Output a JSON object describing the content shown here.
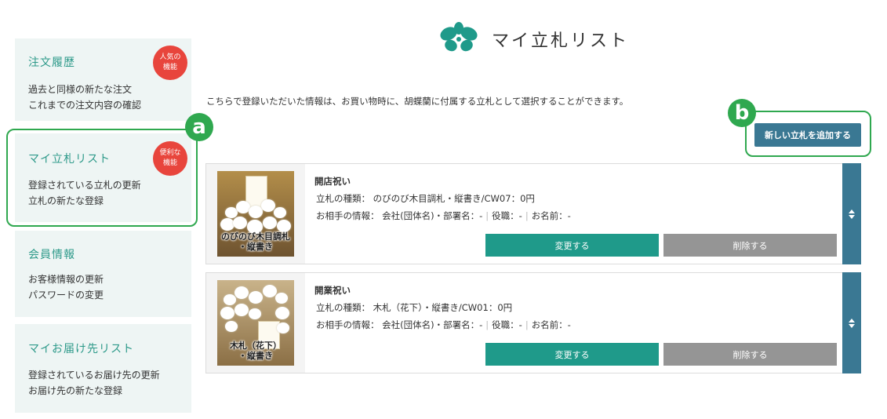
{
  "sidebar": {
    "cards": [
      {
        "title": "注文履歴",
        "badge": [
          "人気の",
          "機能"
        ],
        "lines": [
          "過去と同様の新たな注文",
          "これまでの注文内容の確認"
        ]
      },
      {
        "title": "マイ立札リスト",
        "badge": [
          "便利な",
          "機能"
        ],
        "lines": [
          "登録されている立札の更新",
          "立札の新たな登録"
        ]
      },
      {
        "title": "会員情報",
        "lines": [
          "お客様情報の更新",
          "パスワードの変更"
        ]
      },
      {
        "title": "マイお届け先リスト",
        "lines": [
          "登録されているお届け先の更新",
          "お届け先の新たな登録"
        ]
      }
    ]
  },
  "annotations": {
    "a": "a",
    "b": "b",
    "color": "#2fa84f"
  },
  "header": {
    "title": "マイ立札リスト",
    "logo_icon": "orchid-logo-icon",
    "logo_color": "#1f9a8a"
  },
  "intro": "こちらで登録いただいた情報は、お買い物時に、胡蝶蘭に付属する立札として選択することができます。",
  "add_button": "新しい立札を追加する",
  "items": [
    {
      "name": "開店祝い",
      "type_label": "立札の種類：",
      "type_value": "のびのび木目調札・縦書き/CW07：0円",
      "partner_label": "お相手の情報：",
      "company": "会社(団体名)・部署名：-",
      "position": "役職：-",
      "person": "お名前：-",
      "thumb_caption": [
        "のびのび木目調札",
        "・縦書き"
      ],
      "edit": "変更する",
      "delete": "削除する"
    },
    {
      "name": "開業祝い",
      "type_label": "立札の種類：",
      "type_value": "木札（花下）・縦書き/CW01：0円",
      "partner_label": "お相手の情報：",
      "company": "会社(団体名)・部署名：-",
      "position": "役職：-",
      "person": "お名前：-",
      "thumb_caption": [
        "木札（花下）",
        "・縦書き"
      ],
      "edit": "変更する",
      "delete": "削除する"
    }
  ],
  "colors": {
    "accent": "#1f9a8a",
    "primary": "#3a7893",
    "badge": "#e8453c",
    "delete": "#959595",
    "sidebar_bg": "#eef5f4"
  }
}
